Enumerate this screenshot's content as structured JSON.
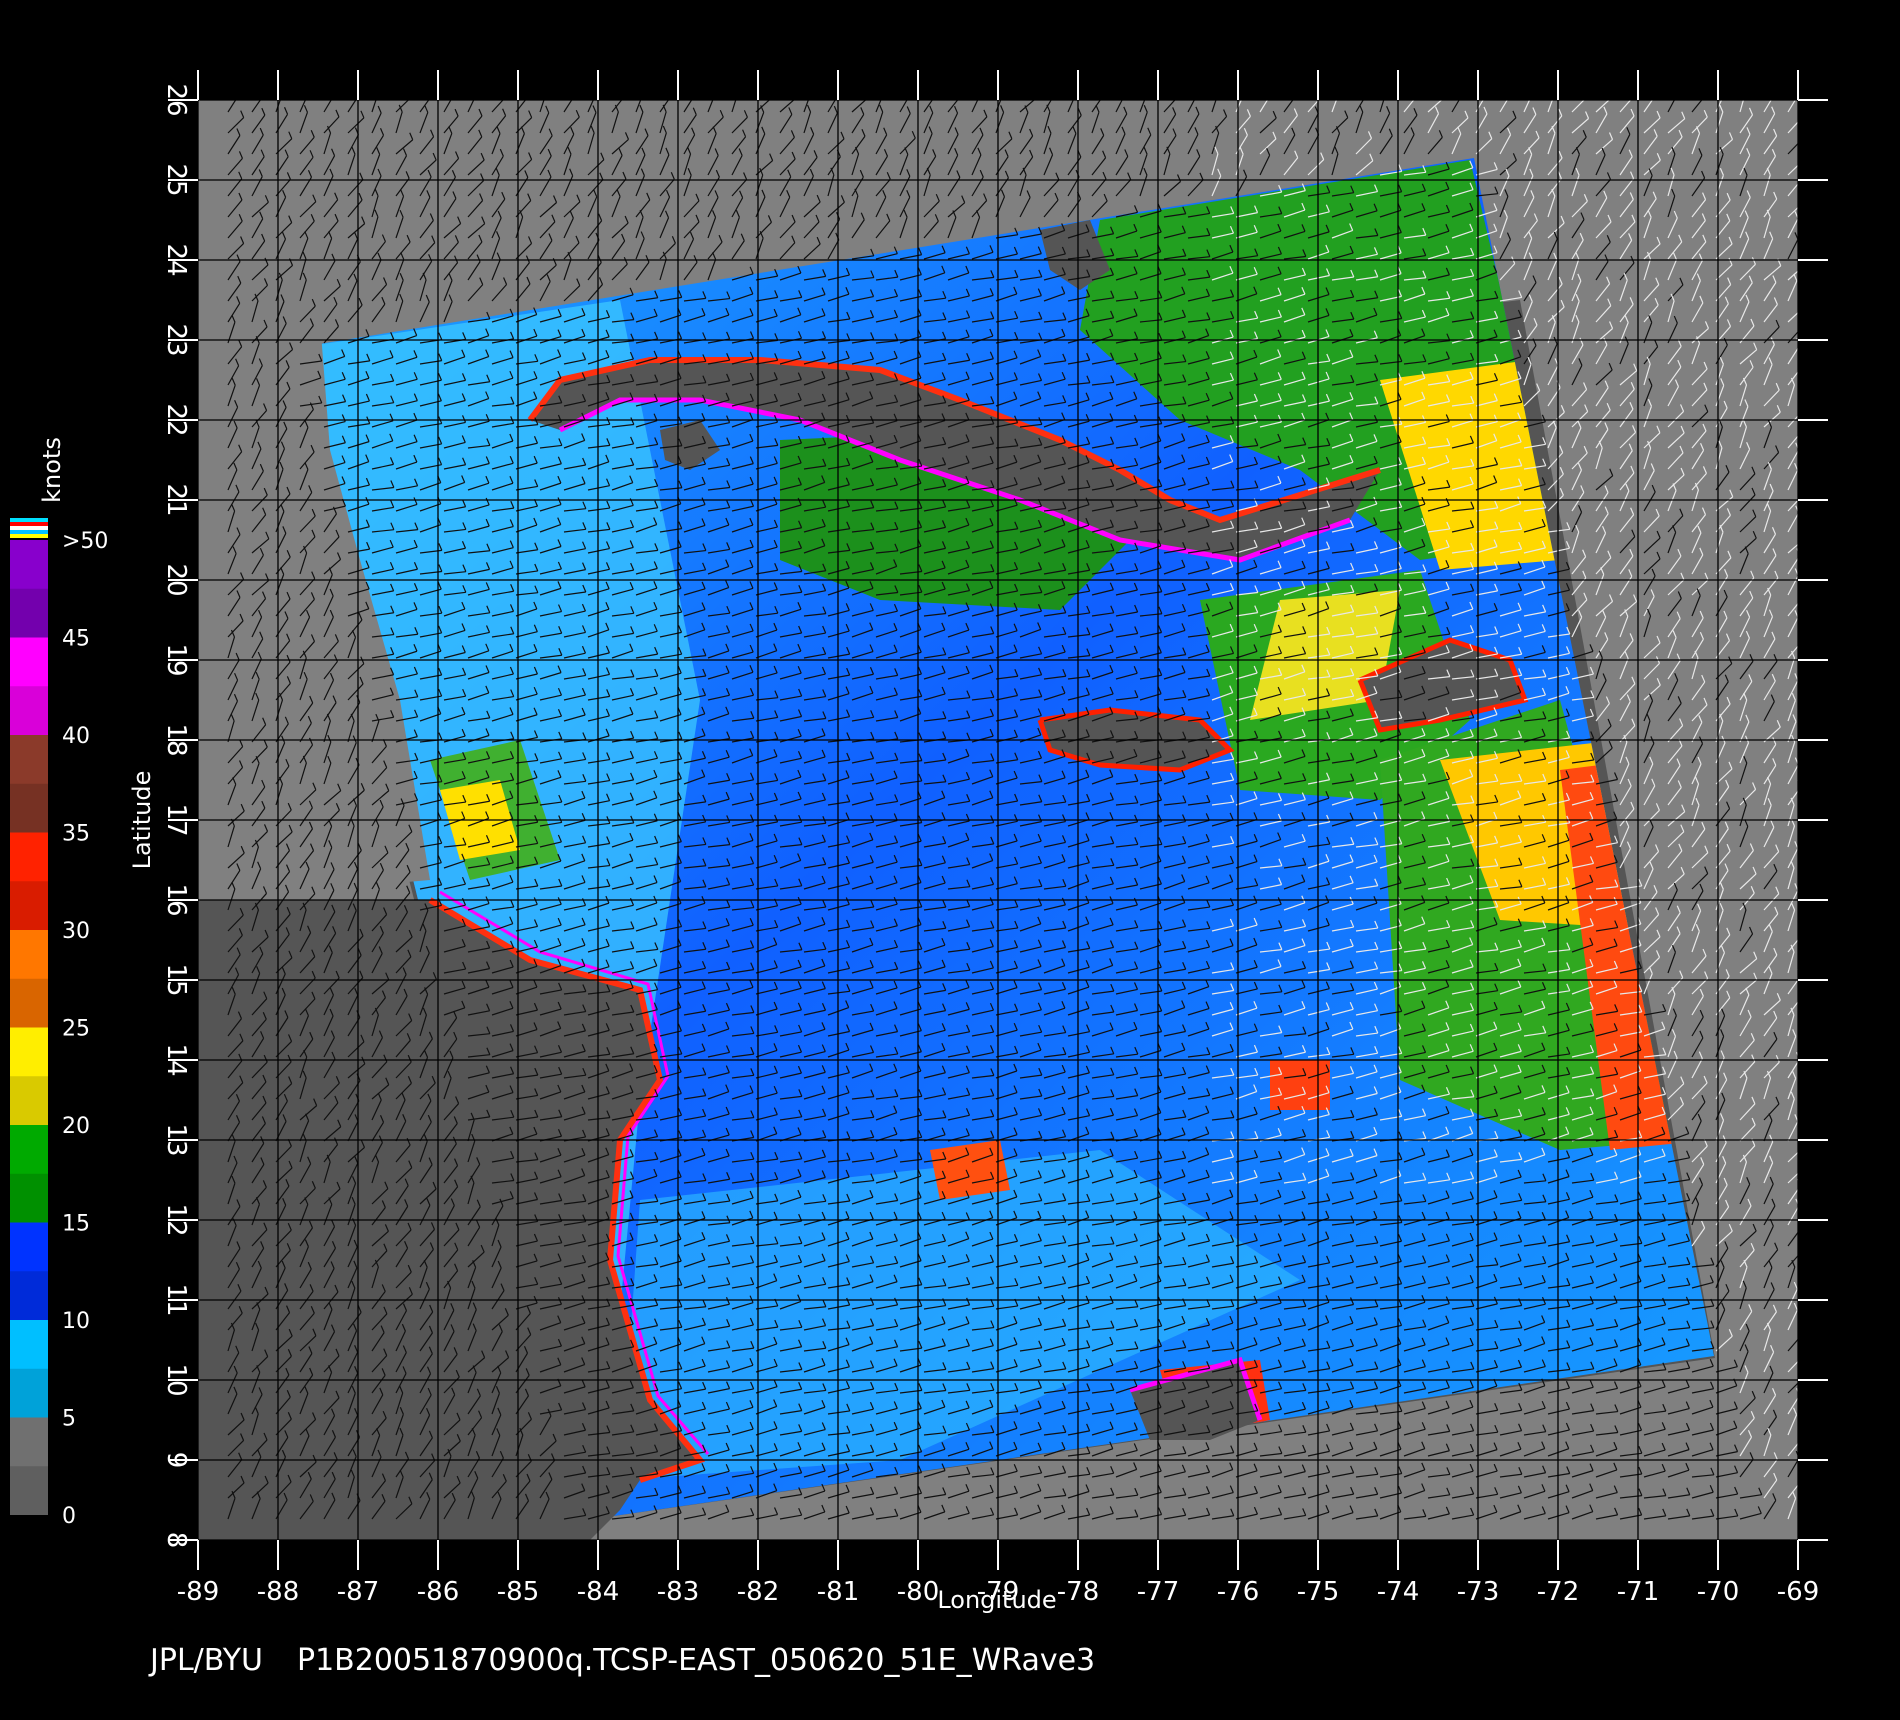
{
  "footer": {
    "source": "JPL/BYU",
    "file_id": "P1B20051870900q.TCSP-EAST_050620_51E_WRave3"
  },
  "map": {
    "xlabel": "Longitude",
    "ylabel": "Latitude",
    "lon_range": [
      -89,
      -69
    ],
    "lat_range": [
      8,
      26
    ],
    "lon_ticks": [
      "-89",
      "-88",
      "-87",
      "-86",
      "-85",
      "-84",
      "-83",
      "-82",
      "-81",
      "-80",
      "-79",
      "-78",
      "-77",
      "-76",
      "-75",
      "-74",
      "-73",
      "-72",
      "-71",
      "-70",
      "-69"
    ],
    "lat_ticks": [
      "8",
      "9",
      "10",
      "11",
      "12",
      "13",
      "14",
      "15",
      "16",
      "17",
      "18",
      "19",
      "20",
      "21",
      "22",
      "23",
      "24",
      "25",
      "26"
    ],
    "grid": true,
    "background_color": "#808080",
    "land_color": "#555555"
  },
  "colorbar": {
    "title": "knots",
    "labels": [
      "0",
      "5",
      "10",
      "15",
      "20",
      "25",
      "30",
      "35",
      "40",
      "45",
      ">50"
    ],
    "colors": {
      "0_5": "#707070",
      "5_10": "#00bfff",
      "10_15": "#0033ff",
      "15_20": "#00aa00",
      "20_25": "#ffee00",
      "25_30": "#ff7700",
      "30_35": "#ff2200",
      "35_40": "#8b3a2a",
      "40_45": "#ff00ff",
      "45_50": "#8800cc"
    }
  }
}
